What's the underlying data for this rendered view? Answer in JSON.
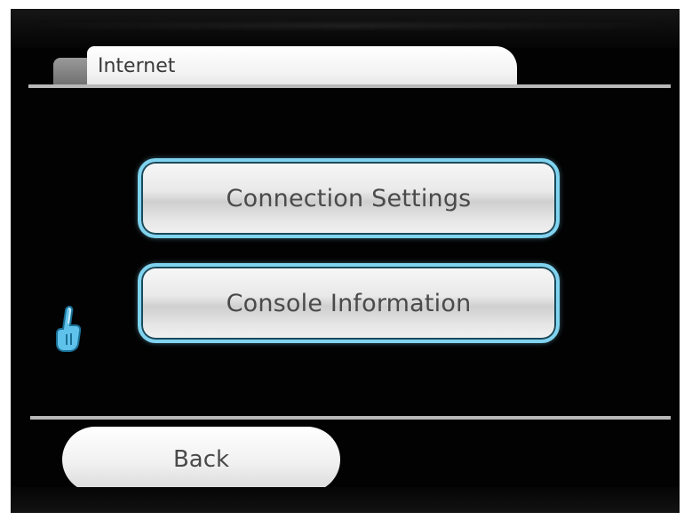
{
  "header": {
    "tab_title": "Internet"
  },
  "menu": {
    "items": [
      {
        "label": "Connection Settings"
      },
      {
        "label": "Console Information"
      }
    ]
  },
  "footer": {
    "back_label": "Back"
  },
  "cursor": {
    "icon": "hand-pointer-icon"
  },
  "colors": {
    "background": "#020202",
    "button_border": "#7fd3ef",
    "button_text": "#4a4a4a",
    "tab_bg": "#ffffff"
  }
}
